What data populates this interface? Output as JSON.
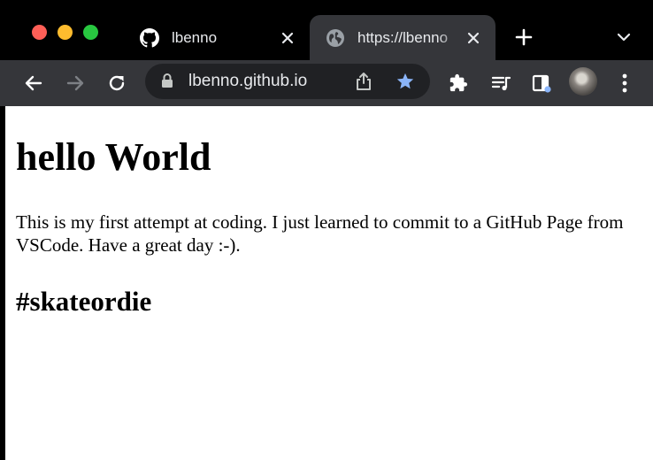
{
  "browser": {
    "traffic_lights": {
      "close": "#ff5f57",
      "minimize": "#febc2e",
      "zoom": "#28c840"
    },
    "tabs": [
      {
        "title": "lbenno",
        "icon": "github-icon",
        "active": false
      },
      {
        "title": "https://lbenno",
        "icon": "globe-icon",
        "active": true
      }
    ],
    "address_bar": {
      "url": "lbenno.github.io",
      "bookmarked": true
    },
    "accent": "#8ab4f8"
  },
  "page": {
    "heading": "hello World",
    "paragraph": "This is my first attempt at coding. I just learned to commit to a GitHub Page from VSCode. Have a great day :-).",
    "subheading": "#skateordie"
  }
}
